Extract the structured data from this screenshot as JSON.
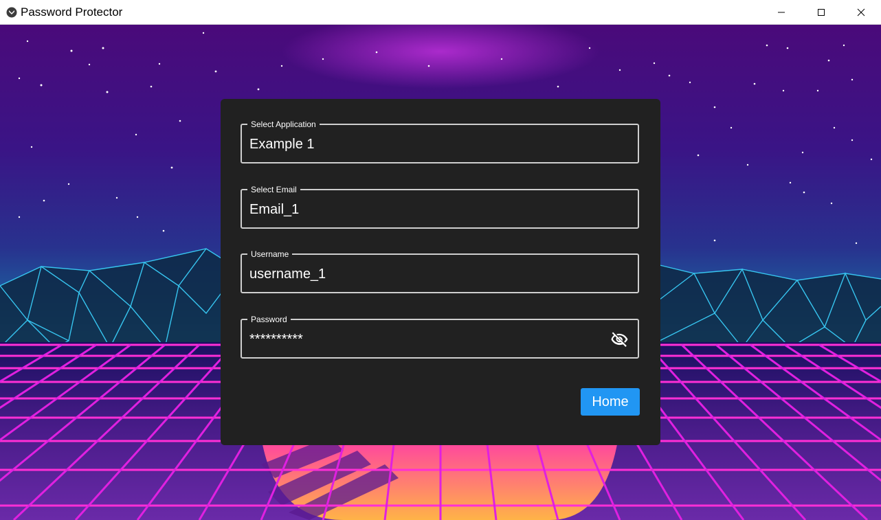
{
  "window": {
    "title": "Password Protector",
    "icon": "kivy-logo-icon",
    "controls": [
      "minimize-icon",
      "maximize-icon",
      "close-icon"
    ]
  },
  "form": {
    "application": {
      "label": "Select Application",
      "value": "Example 1"
    },
    "email": {
      "label": "Select Email",
      "value": "Email_1"
    },
    "username": {
      "label": "Username",
      "value": "username_1"
    },
    "password": {
      "label": "Password",
      "value": "**********",
      "toggle_icon": "eye-off-icon"
    },
    "home_label": "Home"
  },
  "colors": {
    "card_bg": "#212121",
    "field_border": "#cfcfcf",
    "accent": "#2196f3",
    "text": "#ffffff"
  }
}
